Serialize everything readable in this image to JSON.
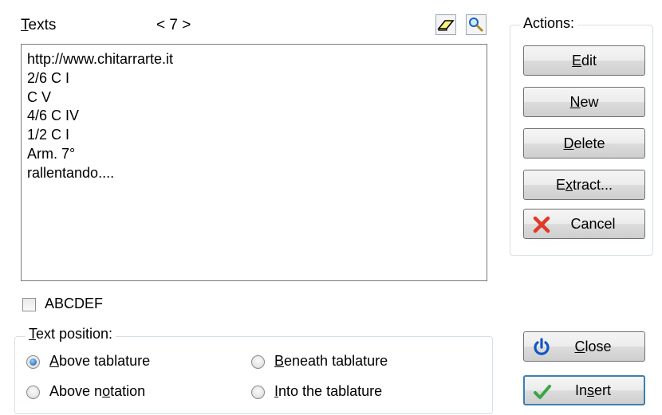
{
  "header": {
    "texts_label_prefix": "T",
    "texts_label_rest": "exts",
    "counter": "< 7 >"
  },
  "text_list": {
    "lines": [
      "http://www.chitarrarte.it",
      "2/6 C I",
      "C V",
      "4/6 C IV",
      "1/2 C I",
      "Arm. 7°",
      "rallentando...."
    ]
  },
  "abc_checkbox": {
    "label": "ABCDEF",
    "checked": false
  },
  "text_position": {
    "legend_prefix": "T",
    "legend_rest": "ext position:",
    "options": [
      {
        "pre": "",
        "key": "A",
        "post": "bove tablature",
        "checked": true
      },
      {
        "pre": "Above n",
        "key": "o",
        "post": "tation",
        "checked": false
      },
      {
        "pre": "",
        "key": "B",
        "post": "eneath tablature",
        "checked": false
      },
      {
        "pre": "",
        "key": "I",
        "post": "nto the tablature",
        "checked": false
      }
    ]
  },
  "actions": {
    "legend": "Actions:",
    "edit": {
      "key": "E",
      "rest": "dit"
    },
    "new": {
      "key": "N",
      "rest": "ew"
    },
    "delete": {
      "key": "D",
      "rest": "elete"
    },
    "extract": {
      "pre": "E",
      "key": "x",
      "rest": "tract..."
    },
    "cancel": {
      "label": "Cancel",
      "icon": "red-x-icon"
    }
  },
  "close": {
    "key": "C",
    "rest": "lose",
    "icon": "power-icon"
  },
  "insert": {
    "pre": "In",
    "key": "s",
    "rest": "ert",
    "icon": "green-check-icon"
  },
  "colors": {
    "focus_border": "#3c7fb1",
    "power_blue": "#1256c4",
    "check_green": "#3aa641",
    "x_red": "#e03a2a"
  }
}
